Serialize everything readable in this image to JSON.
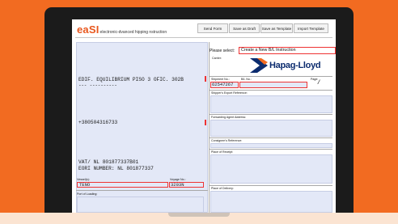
{
  "app": {
    "logo_main": "eaSI",
    "logo_sub": "electronic-dvanced hipping nstruction"
  },
  "toolbar": {
    "buttons": [
      "Send Form",
      "Save as Draft",
      "Save as Template",
      "Import Template"
    ]
  },
  "shipper": {
    "line1": "EDIF. EQUILIBRIUM PISO 3 OFIC. 302B",
    "line2": "--- ----------",
    "phone": "+380504316733",
    "vat": "VAT/ NL 801877337B01",
    "eori": "EORI NUMBER: NL 801877337"
  },
  "vessel": {
    "label": "Vessel(s):",
    "value": "TENO"
  },
  "voyage": {
    "label": "Voyage No.:",
    "value": "3203N"
  },
  "port_of_loading": {
    "label": "Port of Loading:"
  },
  "selector": {
    "label": "Please select:",
    "value": "Create a New B/L Instruction"
  },
  "carrier": {
    "label": "Carrier:",
    "name": "Hapag-Lloyd"
  },
  "shipment": {
    "shipment_label": "Shipment No.:",
    "shipment_value": "62547267",
    "bl_label": "B/L No.:",
    "bl_value": "",
    "page_label": "Page:",
    "page_value": "/"
  },
  "references": {
    "shipper_export": "Shipper's Export Reference:",
    "forwarding_agent": "Forwarding Agent Address:",
    "consignee": "Consignee's Reference:",
    "place_of_receipt": "Place of Receipt:",
    "place_of_delivery": "Place of Delivery:"
  },
  "colors": {
    "background": "#f26b21",
    "accent": "#e8571d",
    "field": "#e3e8f7",
    "required_border": "#ee3333",
    "carrier_brand": "#0b2b6e"
  }
}
